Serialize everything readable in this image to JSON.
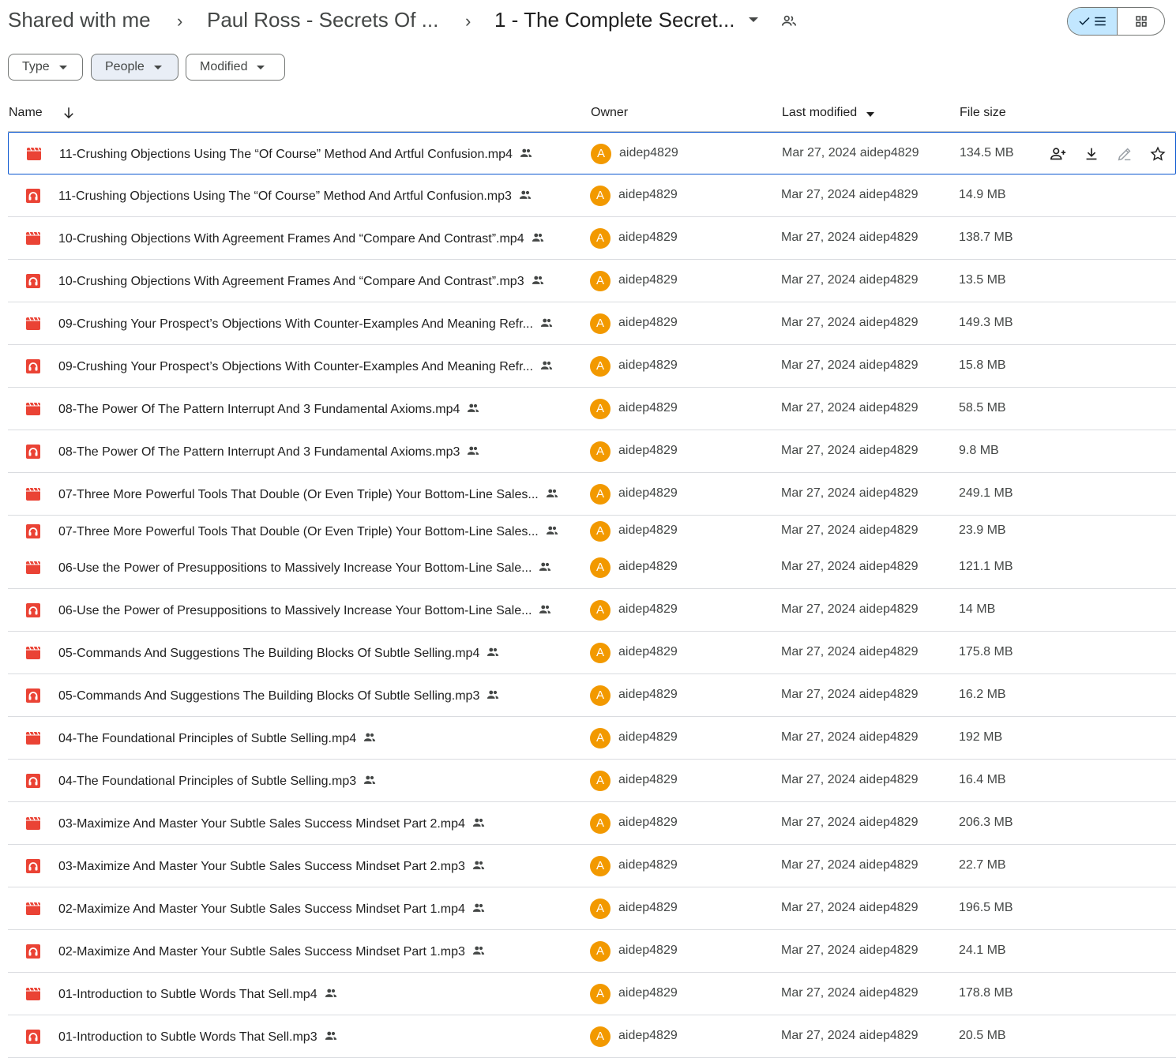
{
  "breadcrumb": {
    "root": "Shared with me",
    "parent": "Paul Ross - Secrets Of ...",
    "current": "1 - The Complete Secret..."
  },
  "filters": {
    "type": "Type",
    "people": "People",
    "modified": "Modified"
  },
  "columns": {
    "name": "Name",
    "owner": "Owner",
    "last_modified": "Last modified",
    "file_size": "File size"
  },
  "files": [
    {
      "name": "11-Crushing Objections Using The “Of Course” Method And Artful Confusion.mp4",
      "kind": "video",
      "owner": "aidep4829",
      "avatar": "A",
      "modified": "Mar 27, 2024 aidep4829",
      "size": "134.5 MB"
    },
    {
      "name": "11-Crushing Objections Using The “Of Course” Method And Artful Confusion.mp3",
      "kind": "audio",
      "owner": "aidep4829",
      "avatar": "A",
      "modified": "Mar 27, 2024 aidep4829",
      "size": "14.9 MB"
    },
    {
      "name": "10-Crushing Objections With Agreement Frames And “Compare And Contrast”.mp4",
      "kind": "video",
      "owner": "aidep4829",
      "avatar": "A",
      "modified": "Mar 27, 2024 aidep4829",
      "size": "138.7 MB"
    },
    {
      "name": "10-Crushing Objections With Agreement Frames And “Compare And Contrast”.mp3",
      "kind": "audio",
      "owner": "aidep4829",
      "avatar": "A",
      "modified": "Mar 27, 2024 aidep4829",
      "size": "13.5 MB"
    },
    {
      "name": "09-Crushing Your Prospect’s Objections With Counter-Examples And Meaning Refr...",
      "kind": "video",
      "owner": "aidep4829",
      "avatar": "A",
      "modified": "Mar 27, 2024 aidep4829",
      "size": "149.3 MB"
    },
    {
      "name": "09-Crushing Your Prospect’s Objections With Counter-Examples And Meaning Refr...",
      "kind": "audio",
      "owner": "aidep4829",
      "avatar": "A",
      "modified": "Mar 27, 2024 aidep4829",
      "size": "15.8 MB"
    },
    {
      "name": "08-The Power Of The Pattern Interrupt And 3 Fundamental Axioms.mp4",
      "kind": "video",
      "owner": "aidep4829",
      "avatar": "A",
      "modified": "Mar 27, 2024 aidep4829",
      "size": "58.5 MB"
    },
    {
      "name": "08-The Power Of The Pattern Interrupt And 3 Fundamental Axioms.mp3",
      "kind": "audio",
      "owner": "aidep4829",
      "avatar": "A",
      "modified": "Mar 27, 2024 aidep4829",
      "size": "9.8 MB"
    },
    {
      "name": "07-Three More Powerful Tools That Double (Or Even Triple) Your Bottom-Line Sales...",
      "kind": "video",
      "owner": "aidep4829",
      "avatar": "A",
      "modified": "Mar 27, 2024 aidep4829",
      "size": "249.1 MB"
    },
    {
      "name": "07-Three More Powerful Tools That Double (Or Even Triple) Your Bottom-Line Sales...",
      "kind": "audio",
      "owner": "aidep4829",
      "avatar": "A",
      "modified": "Mar 27, 2024 aidep4829",
      "size": "23.9 MB"
    },
    {
      "name": "06-Use the Power of Presuppositions to Massively Increase Your Bottom-Line Sale...",
      "kind": "video",
      "owner": "aidep4829",
      "avatar": "A",
      "modified": "Mar 27, 2024 aidep4829",
      "size": "121.1 MB"
    },
    {
      "name": "06-Use the Power of Presuppositions to Massively Increase Your Bottom-Line Sale...",
      "kind": "audio",
      "owner": "aidep4829",
      "avatar": "A",
      "modified": "Mar 27, 2024 aidep4829",
      "size": "14 MB"
    },
    {
      "name": "05-Commands And Suggestions The Building Blocks Of Subtle Selling.mp4",
      "kind": "video",
      "owner": "aidep4829",
      "avatar": "A",
      "modified": "Mar 27, 2024 aidep4829",
      "size": "175.8 MB"
    },
    {
      "name": "05-Commands And Suggestions The Building Blocks Of Subtle Selling.mp3",
      "kind": "audio",
      "owner": "aidep4829",
      "avatar": "A",
      "modified": "Mar 27, 2024 aidep4829",
      "size": "16.2 MB"
    },
    {
      "name": "04-The Foundational Principles of Subtle Selling.mp4",
      "kind": "video",
      "owner": "aidep4829",
      "avatar": "A",
      "modified": "Mar 27, 2024 aidep4829",
      "size": "192 MB"
    },
    {
      "name": "04-The Foundational Principles of Subtle Selling.mp3",
      "kind": "audio",
      "owner": "aidep4829",
      "avatar": "A",
      "modified": "Mar 27, 2024 aidep4829",
      "size": "16.4 MB"
    },
    {
      "name": "03-Maximize And Master Your Subtle Sales Success Mindset Part 2.mp4",
      "kind": "video",
      "owner": "aidep4829",
      "avatar": "A",
      "modified": "Mar 27, 2024 aidep4829",
      "size": "206.3 MB"
    },
    {
      "name": "03-Maximize And Master Your Subtle Sales Success Mindset Part 2.mp3",
      "kind": "audio",
      "owner": "aidep4829",
      "avatar": "A",
      "modified": "Mar 27, 2024 aidep4829",
      "size": "22.7 MB"
    },
    {
      "name": "02-Maximize And Master Your Subtle Sales Success Mindset Part 1.mp4",
      "kind": "video",
      "owner": "aidep4829",
      "avatar": "A",
      "modified": "Mar 27, 2024 aidep4829",
      "size": "196.5 MB"
    },
    {
      "name": "02-Maximize And Master Your Subtle Sales Success Mindset Part 1.mp3",
      "kind": "audio",
      "owner": "aidep4829",
      "avatar": "A",
      "modified": "Mar 27, 2024 aidep4829",
      "size": "24.1 MB"
    },
    {
      "name": "01-Introduction to Subtle Words That Sell.mp4",
      "kind": "video",
      "owner": "aidep4829",
      "avatar": "A",
      "modified": "Mar 27, 2024 aidep4829",
      "size": "178.8 MB"
    },
    {
      "name": "01-Introduction to Subtle Words That Sell.mp3",
      "kind": "audio",
      "owner": "aidep4829",
      "avatar": "A",
      "modified": "Mar 27, 2024 aidep4829",
      "size": "20.5 MB"
    }
  ],
  "colors": {
    "file_icon": "#ea4335",
    "avatar": "#f29900",
    "accent": "#0b57d0",
    "toggle_selected": "#c2e7ff"
  }
}
